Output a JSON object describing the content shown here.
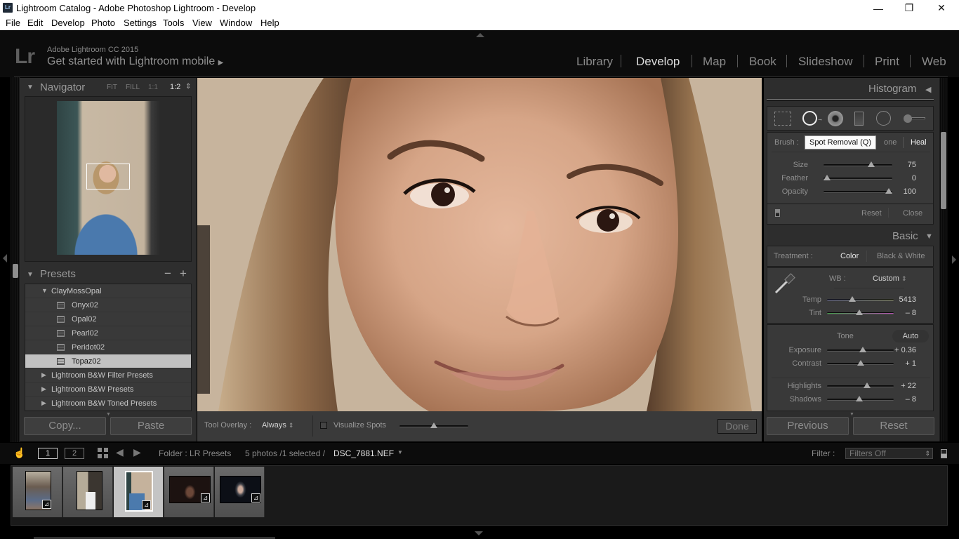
{
  "window": {
    "app_icon": "Lr",
    "title": "Lightroom Catalog - Adobe Photoshop Lightroom - Develop",
    "controls": {
      "minimize": "—",
      "restore": "❐",
      "close": "✕"
    }
  },
  "menu": [
    "File",
    "Edit",
    "Develop",
    "Photo",
    "Settings",
    "Tools",
    "View",
    "Window",
    "Help"
  ],
  "header": {
    "logo": "Lr",
    "product": "Adobe Lightroom CC 2015",
    "mobile_prompt": "Get started with Lightroom mobile",
    "mobile_arrow": "▶",
    "modules": [
      "Library",
      "Develop",
      "Map",
      "Book",
      "Slideshow",
      "Print",
      "Web"
    ],
    "active_module": "Develop"
  },
  "navigator": {
    "title": "Navigator",
    "options": [
      "FIT",
      "FILL",
      "1:1",
      "1:2"
    ],
    "active_option": "1:2",
    "stepper": "⇕"
  },
  "presets": {
    "title": "Presets",
    "minus": "−",
    "plus": "+",
    "groups": [
      {
        "name": "ClayMossOpal",
        "expanded": true,
        "items": [
          "Onyx02",
          "Opal02",
          "Pearl02",
          "Peridot02",
          "Topaz02"
        ]
      },
      {
        "name": "Lightroom B&W Filter Presets",
        "expanded": false
      },
      {
        "name": "Lightroom B&W Presets",
        "expanded": false
      },
      {
        "name": "Lightroom B&W Toned Presets",
        "expanded": false
      }
    ],
    "selected": "Topaz02"
  },
  "left_buttons": {
    "copy": "Copy...",
    "paste": "Paste"
  },
  "toolbar": {
    "tool_overlay_label": "Tool Overlay :",
    "tool_overlay_value": "Always",
    "visualize_spots_label": "Visualize Spots",
    "visualize_spots_checked": false,
    "visualize_threshold": 0.5,
    "done": "Done"
  },
  "right_panel": {
    "histogram_title": "Histogram",
    "tools": [
      "crop-overlay",
      "spot-removal",
      "red-eye",
      "graduated-filter",
      "radial-filter",
      "adjustment-brush"
    ],
    "active_tool": "spot-removal",
    "tooltip": "Spot Removal (Q)",
    "brush_label": "Brush :",
    "brush_modes": [
      "Clone",
      "Heal"
    ],
    "brush_mode_partial": "one",
    "active_brush": "Heal",
    "spot_sliders": [
      {
        "label": "Size",
        "value": "75",
        "position": 0.72
      },
      {
        "label": "Feather",
        "value": "0",
        "position": 0.0
      },
      {
        "label": "Opacity",
        "value": "100",
        "position": 1.0
      }
    ],
    "reset": "Reset",
    "close": "Close",
    "basic_title": "Basic",
    "treatment_label": "Treatment :",
    "treatment_options": [
      "Color",
      "Black & White"
    ],
    "active_treatment": "Color",
    "wb_label": "WB :",
    "wb_value": "Custom",
    "wb_sliders": [
      {
        "label": "Temp",
        "value": "5413",
        "position": 0.37
      },
      {
        "label": "Tint",
        "value": "– 8",
        "position": 0.48
      }
    ],
    "tone_label": "Tone",
    "auto": "Auto",
    "tone_sliders": [
      {
        "label": "Exposure",
        "value": "+ 0.36",
        "position": 0.54
      },
      {
        "label": "Contrast",
        "value": "+ 1",
        "position": 0.505
      },
      {
        "label": "Highlights",
        "value": "+ 22",
        "position": 0.61
      },
      {
        "label": "Shadows",
        "value": "– 8",
        "position": 0.48
      }
    ],
    "previous": "Previous",
    "reset_button": "Reset"
  },
  "filmbar": {
    "view1": "1",
    "view2": "2",
    "folder": "Folder : LR Presets",
    "count": "5 photos /1 selected /",
    "filename": "DSC_7881.NEF",
    "filter_label": "Filter :",
    "filter_value": "Filters Off"
  },
  "filmstrip": {
    "thumbnails": [
      {
        "name": "street-portrait-man",
        "selected": false,
        "edited": true
      },
      {
        "name": "portrait-woman-white-top",
        "selected": false,
        "edited": false
      },
      {
        "name": "portrait-woman-blue-top",
        "selected": true,
        "edited": true
      },
      {
        "name": "night-portrait-1",
        "selected": false,
        "edited": true
      },
      {
        "name": "night-portrait-2",
        "selected": false,
        "edited": true
      }
    ]
  }
}
